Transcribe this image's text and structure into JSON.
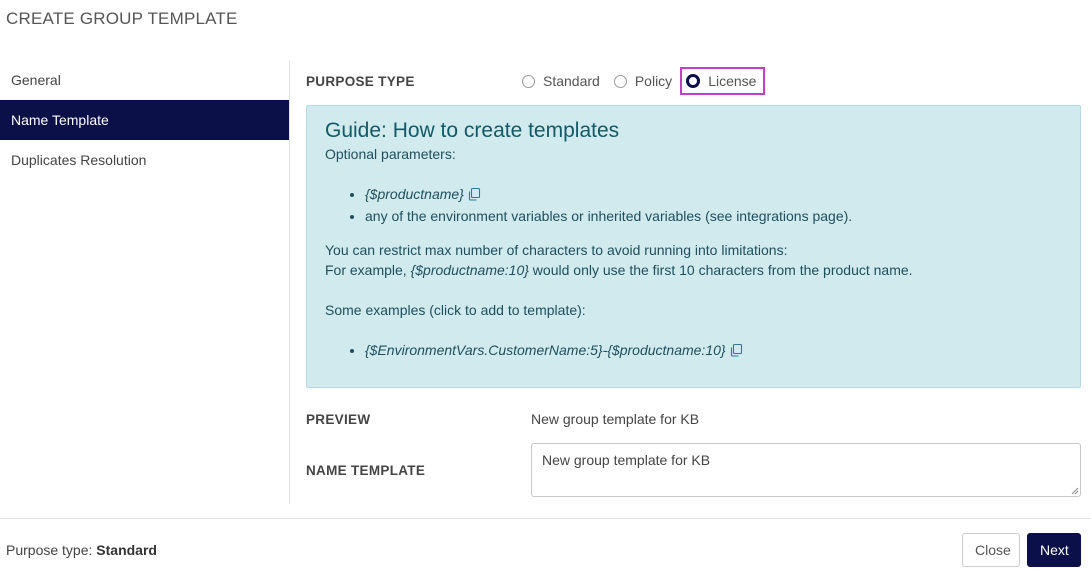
{
  "dialog": {
    "title": "CREATE GROUP TEMPLATE"
  },
  "sidebar": {
    "items": [
      {
        "label": "General",
        "active": false
      },
      {
        "label": "Name Template",
        "active": true
      },
      {
        "label": "Duplicates Resolution",
        "active": false
      }
    ]
  },
  "purpose": {
    "label": "PURPOSE TYPE",
    "options": [
      {
        "label": "Standard",
        "selected": false
      },
      {
        "label": "Policy",
        "selected": false
      },
      {
        "label": "License",
        "selected": true
      }
    ]
  },
  "guide": {
    "title": "Guide: How to create templates",
    "optional_label": "Optional parameters:",
    "params": [
      "{$productname}",
      "any of the environment variables or inherited variables (see integrations page)."
    ],
    "restrict_line": "You can restrict max number of characters to avoid running into limitations:",
    "example_prefix": "For example, ",
    "example_code": "{$productname:10}",
    "example_suffix": " would only use the first 10 characters from the product name.",
    "examples_label": "Some examples (click to add to template):",
    "examples": [
      "{$EnvironmentVars.CustomerName:5}-{$productname:10}"
    ],
    "icon": "copy-icon"
  },
  "preview": {
    "label": "PREVIEW",
    "value": "New group template for KB"
  },
  "name_template": {
    "label": "NAME TEMPLATE",
    "value": "New group template for KB"
  },
  "footer": {
    "status_label": "Purpose type: ",
    "status_value": "Standard",
    "close_label": "Close",
    "next_label": "Next"
  },
  "colors": {
    "accent": "#0c1048",
    "highlight": "#c43fc9",
    "guide_bg": "#d1eaee"
  }
}
